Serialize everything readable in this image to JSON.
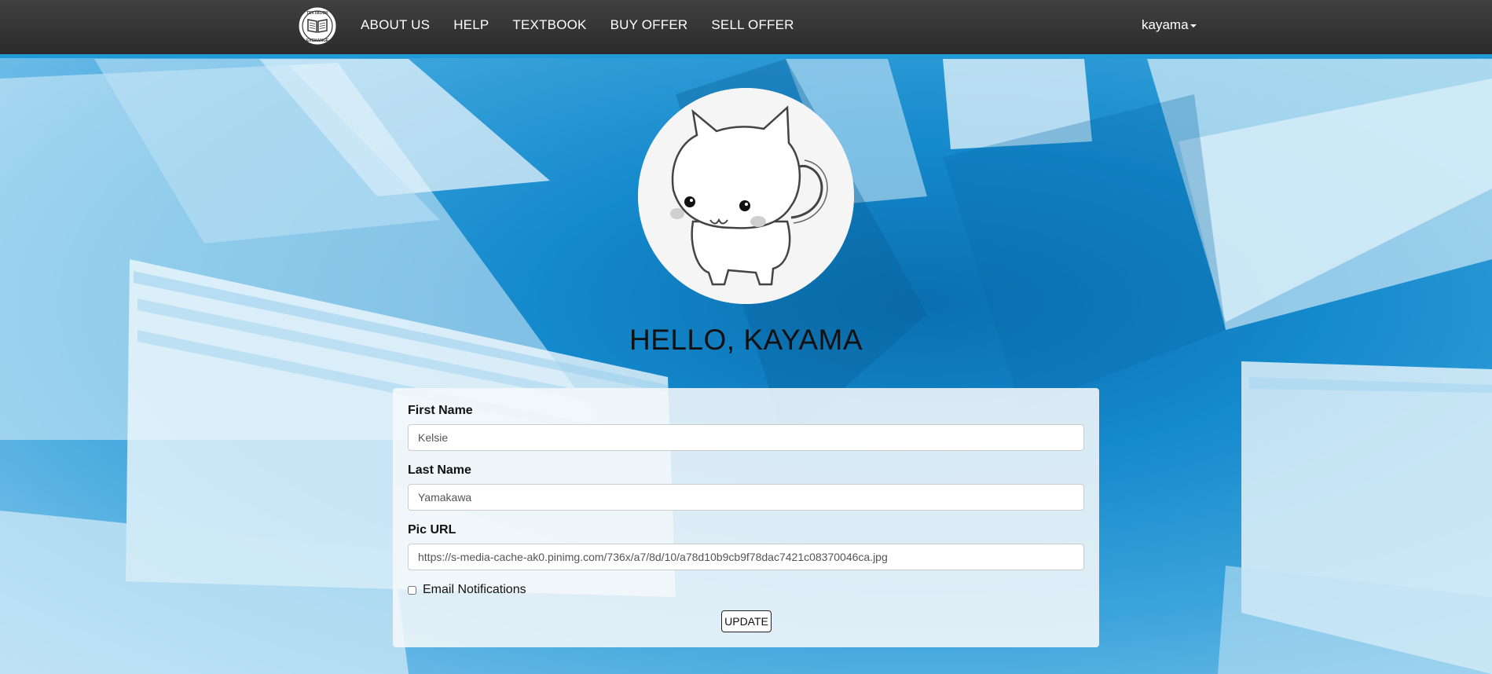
{
  "nav": {
    "logo_top_text": "TEXTBOOK",
    "logo_bottom_text": "EXCHANGE",
    "links": [
      "ABOUT US",
      "HELP",
      "TEXTBOOK",
      "BUY OFFER",
      "SELL OFFER"
    ],
    "user": "kayama"
  },
  "profile": {
    "greeting": "HELLO, KAYAMA"
  },
  "form": {
    "first_name_label": "First Name",
    "first_name_value": "Kelsie",
    "last_name_label": "Last Name",
    "last_name_value": "Yamakawa",
    "pic_url_label": "Pic URL",
    "pic_url_value": "https://s-media-cache-ak0.pinimg.com/736x/a7/8d/10/a78d10b9cb9f78dac7421c08370046ca.jpg",
    "email_notifications_label": "Email Notifications",
    "email_notifications_checked": false,
    "update_label": "UPDATE"
  },
  "colors": {
    "navbar": "#333333",
    "accent": "#1f9ad6",
    "background": "#1a8fcf"
  }
}
